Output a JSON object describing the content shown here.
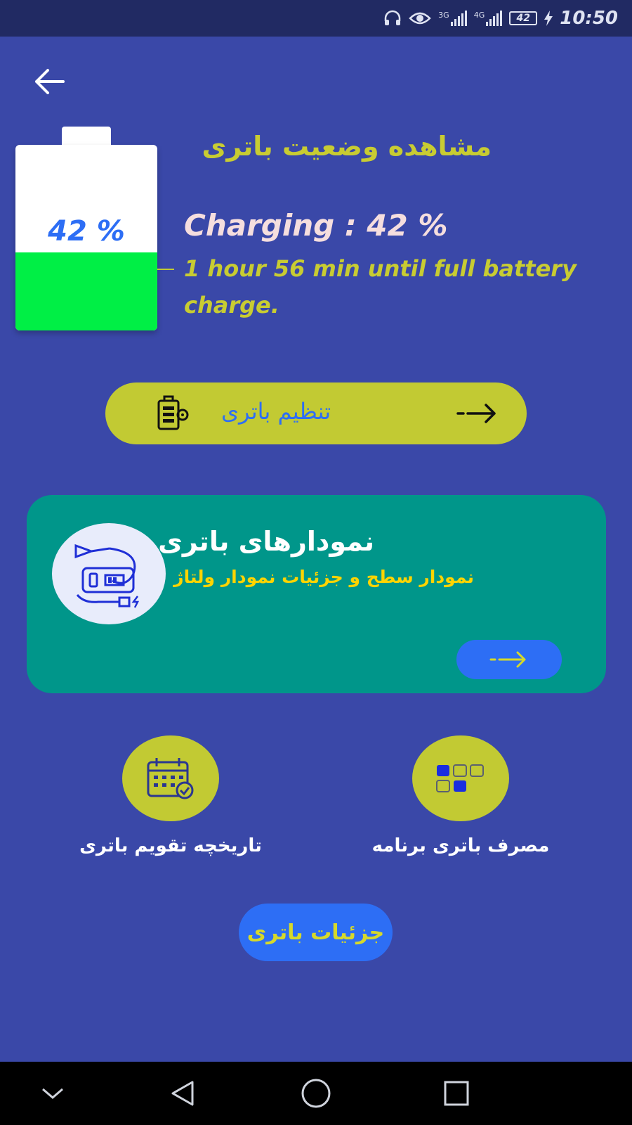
{
  "status_bar": {
    "network_3g": "3G",
    "network_4g": "4G",
    "battery_level": "42",
    "time": "10:50"
  },
  "header": {
    "title": "مشاهده وضعیت باتری"
  },
  "battery": {
    "percent_label": "42 %",
    "level_percent": 42,
    "charging_status": "Charging : 42 %",
    "time_remaining": "1 hour 56 min until full battery charge.",
    "fill_color": "#00ef45"
  },
  "settings_button": {
    "label": "تنظیم باتری"
  },
  "charts_card": {
    "title": "نمودارهای باتری",
    "subtitle": "نمودار سطح  و جزئیات نمودار ولتاژ"
  },
  "quick_actions": {
    "history_label": "تاریخچه تقویم باتری",
    "usage_label": "مصرف باتری برنامه"
  },
  "details_button": {
    "label": "جزئیات باتری"
  },
  "colors": {
    "background": "#3a48a8",
    "accent_yellow": "#c2ca33",
    "accent_blue": "#2d6ef5",
    "card_teal": "#00968a"
  },
  "icons": [
    "headphones-icon",
    "eye-icon",
    "signal-icon",
    "charging-bolt-icon",
    "back-arrow-icon",
    "battery-gear-icon",
    "arrow-right-icon",
    "battery-charger-illustration-icon",
    "calendar-check-icon",
    "app-grid-icon",
    "nav-down-icon",
    "nav-back-icon",
    "nav-home-icon",
    "nav-recents-icon"
  ]
}
